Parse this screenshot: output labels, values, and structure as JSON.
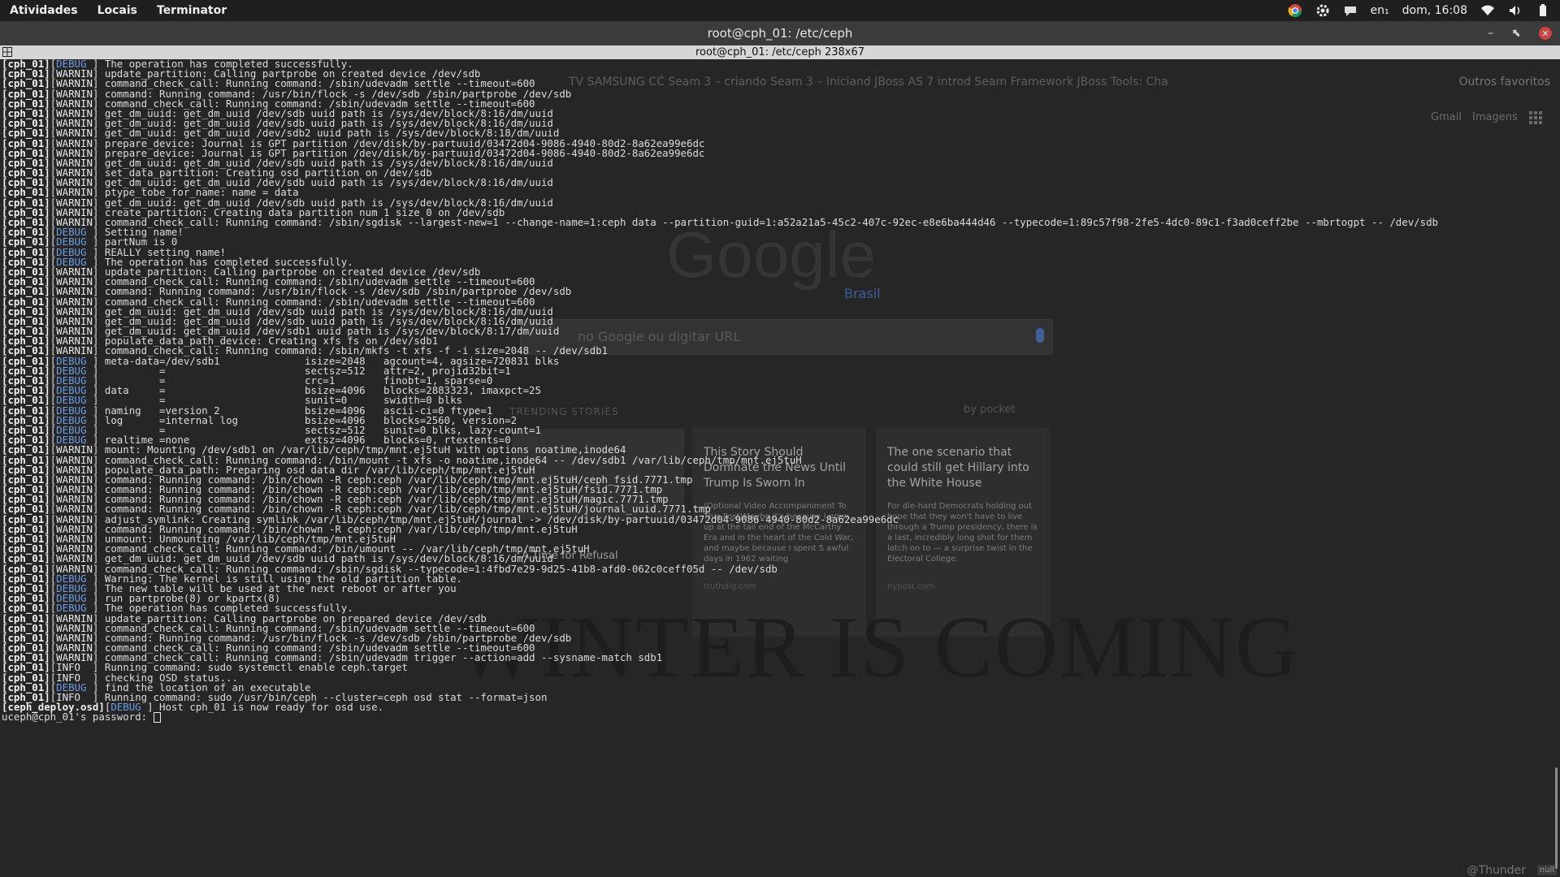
{
  "topbar": {
    "menus": [
      "Atividades",
      "Locais",
      "Terminator"
    ],
    "keyboard": "en₁",
    "clock": "dom, 16:08"
  },
  "window": {
    "title": "root@cph_01: /etc/ceph",
    "tab_title": "root@cph_01: /etc/ceph 238x67"
  },
  "backdrop": {
    "bookmarks": "TV SAMSUNG CĆ    Seam 3 – criando    Seam 3 – Iniciand    JBoss AS 7 introd    Seam Framework    JBoss Tools: Cha",
    "outros_favoritos": "Outros favoritos",
    "gmail": "Gmail",
    "imagens": "Imagens",
    "google_logo": "Google",
    "brasil": "Brasil",
    "search_placeholder": "no Google ou digitar URL",
    "trending": "TRENDING STORIES",
    "pocket": "by pocket",
    "card0_caption": "A Time for Refusal",
    "card1_title": "This Story Should Dominate the News Until Trump Is Sworn In",
    "card1_body": "(Optional Video Accompaniment To This Post)Maybe it's because I grew up at the tail end of the McCarthy Era and in the heart of the Cold War, and maybe because I spent 5 awful days in 1962 waiting",
    "card1_source": "truthdig.com",
    "card2_title": "The one scenario that could still get Hillary into the White House",
    "card2_body": "For die-hard Democrats holding out hope that they won't have to live through a Trump presidency, there is a last, incredibly long shot for them latch on to — a surprise twist in the Electoral College.",
    "card2_source": "nypost.com",
    "winter": "WINTER IS COMING",
    "watermark": "@Thunder",
    "null_badge": "null"
  },
  "terminal": {
    "lines": [
      {
        "host": "cph_01",
        "level": "DEBUG",
        "msg": "The operation has completed successfully."
      },
      {
        "host": "cph_01",
        "level": "WARNIN",
        "msg": "update_partition: Calling partprobe on created device /dev/sdb"
      },
      {
        "host": "cph_01",
        "level": "WARNIN",
        "msg": "command_check_call: Running command: /sbin/udevadm settle --timeout=600"
      },
      {
        "host": "cph_01",
        "level": "WARNIN",
        "msg": "command: Running command: /usr/bin/flock -s /dev/sdb /sbin/partprobe /dev/sdb"
      },
      {
        "host": "cph_01",
        "level": "WARNIN",
        "msg": "command_check_call: Running command: /sbin/udevadm settle --timeout=600"
      },
      {
        "host": "cph_01",
        "level": "WARNIN",
        "msg": "get_dm_uuid: get_dm_uuid /dev/sdb uuid path is /sys/dev/block/8:16/dm/uuid"
      },
      {
        "host": "cph_01",
        "level": "WARNIN",
        "msg": "get_dm_uuid: get_dm_uuid /dev/sdb uuid path is /sys/dev/block/8:16/dm/uuid"
      },
      {
        "host": "cph_01",
        "level": "WARNIN",
        "msg": "get_dm_uuid: get_dm_uuid /dev/sdb2 uuid path is /sys/dev/block/8:18/dm/uuid"
      },
      {
        "host": "cph_01",
        "level": "WARNIN",
        "msg": "prepare_device: Journal is GPT partition /dev/disk/by-partuuid/03472d04-9086-4940-80d2-8a62ea99e6dc"
      },
      {
        "host": "cph_01",
        "level": "WARNIN",
        "msg": "prepare_device: Journal is GPT partition /dev/disk/by-partuuid/03472d04-9086-4940-80d2-8a62ea99e6dc"
      },
      {
        "host": "cph_01",
        "level": "WARNIN",
        "msg": "get_dm_uuid: get_dm_uuid /dev/sdb uuid path is /sys/dev/block/8:16/dm/uuid"
      },
      {
        "host": "cph_01",
        "level": "WARNIN",
        "msg": "set_data_partition: Creating osd partition on /dev/sdb"
      },
      {
        "host": "cph_01",
        "level": "WARNIN",
        "msg": "get_dm_uuid: get_dm_uuid /dev/sdb uuid path is /sys/dev/block/8:16/dm/uuid"
      },
      {
        "host": "cph_01",
        "level": "WARNIN",
        "msg": "ptype_tobe_for_name: name = data"
      },
      {
        "host": "cph_01",
        "level": "WARNIN",
        "msg": "get_dm_uuid: get_dm_uuid /dev/sdb uuid path is /sys/dev/block/8:16/dm/uuid"
      },
      {
        "host": "cph_01",
        "level": "WARNIN",
        "msg": "create_partition: Creating data partition num 1 size 0 on /dev/sdb"
      },
      {
        "host": "cph_01",
        "level": "WARNIN",
        "msg": "command_check_call: Running command: /sbin/sgdisk --largest-new=1 --change-name=1:ceph data --partition-guid=1:a52a21a5-45c2-407c-92ec-e8e6ba444d46 --typecode=1:89c57f98-2fe5-4dc0-89c1-f3ad0ceff2be --mbrtogpt -- /dev/sdb"
      },
      {
        "host": "cph_01",
        "level": "DEBUG",
        "msg": "Setting name!"
      },
      {
        "host": "cph_01",
        "level": "DEBUG",
        "msg": "partNum is 0"
      },
      {
        "host": "cph_01",
        "level": "DEBUG",
        "msg": "REALLY setting name!"
      },
      {
        "host": "cph_01",
        "level": "DEBUG",
        "msg": "The operation has completed successfully."
      },
      {
        "host": "cph_01",
        "level": "WARNIN",
        "msg": "update_partition: Calling partprobe on created device /dev/sdb"
      },
      {
        "host": "cph_01",
        "level": "WARNIN",
        "msg": "command_check_call: Running command: /sbin/udevadm settle --timeout=600"
      },
      {
        "host": "cph_01",
        "level": "WARNIN",
        "msg": "command: Running command: /usr/bin/flock -s /dev/sdb /sbin/partprobe /dev/sdb"
      },
      {
        "host": "cph_01",
        "level": "WARNIN",
        "msg": "command_check_call: Running command: /sbin/udevadm settle --timeout=600"
      },
      {
        "host": "cph_01",
        "level": "WARNIN",
        "msg": "get_dm_uuid: get_dm_uuid /dev/sdb uuid path is /sys/dev/block/8:16/dm/uuid"
      },
      {
        "host": "cph_01",
        "level": "WARNIN",
        "msg": "get_dm_uuid: get_dm_uuid /dev/sdb uuid path is /sys/dev/block/8:16/dm/uuid"
      },
      {
        "host": "cph_01",
        "level": "WARNIN",
        "msg": "get_dm_uuid: get_dm_uuid /dev/sdb1 uuid path is /sys/dev/block/8:17/dm/uuid"
      },
      {
        "host": "cph_01",
        "level": "WARNIN",
        "msg": "populate_data_path_device: Creating xfs fs on /dev/sdb1"
      },
      {
        "host": "cph_01",
        "level": "WARNIN",
        "msg": "command_check_call: Running command: /sbin/mkfs -t xfs -f -i size=2048 -- /dev/sdb1"
      },
      {
        "host": "cph_01",
        "level": "DEBUG",
        "msg": "meta-data=/dev/sdb1              isize=2048   agcount=4, agsize=720831 blks"
      },
      {
        "host": "cph_01",
        "level": "DEBUG",
        "msg": "         =                       sectsz=512   attr=2, projid32bit=1"
      },
      {
        "host": "cph_01",
        "level": "DEBUG",
        "msg": "         =                       crc=1        finobt=1, sparse=0"
      },
      {
        "host": "cph_01",
        "level": "DEBUG",
        "msg": "data     =                       bsize=4096   blocks=2883323, imaxpct=25"
      },
      {
        "host": "cph_01",
        "level": "DEBUG",
        "msg": "         =                       sunit=0      swidth=0 blks"
      },
      {
        "host": "cph_01",
        "level": "DEBUG",
        "msg": "naming   =version 2              bsize=4096   ascii-ci=0 ftype=1"
      },
      {
        "host": "cph_01",
        "level": "DEBUG",
        "msg": "log      =internal log           bsize=4096   blocks=2560, version=2"
      },
      {
        "host": "cph_01",
        "level": "DEBUG",
        "msg": "         =                       sectsz=512   sunit=0 blks, lazy-count=1"
      },
      {
        "host": "cph_01",
        "level": "DEBUG",
        "msg": "realtime =none                   extsz=4096   blocks=0, rtextents=0"
      },
      {
        "host": "cph_01",
        "level": "WARNIN",
        "msg": "mount: Mounting /dev/sdb1 on /var/lib/ceph/tmp/mnt.ej5tuH with options noatime,inode64"
      },
      {
        "host": "cph_01",
        "level": "WARNIN",
        "msg": "command_check_call: Running command: /bin/mount -t xfs -o noatime,inode64 -- /dev/sdb1 /var/lib/ceph/tmp/mnt.ej5tuH"
      },
      {
        "host": "cph_01",
        "level": "WARNIN",
        "msg": "populate_data_path: Preparing osd data dir /var/lib/ceph/tmp/mnt.ej5tuH"
      },
      {
        "host": "cph_01",
        "level": "WARNIN",
        "msg": "command: Running command: /bin/chown -R ceph:ceph /var/lib/ceph/tmp/mnt.ej5tuH/ceph_fsid.7771.tmp"
      },
      {
        "host": "cph_01",
        "level": "WARNIN",
        "msg": "command: Running command: /bin/chown -R ceph:ceph /var/lib/ceph/tmp/mnt.ej5tuH/fsid.7771.tmp"
      },
      {
        "host": "cph_01",
        "level": "WARNIN",
        "msg": "command: Running command: /bin/chown -R ceph:ceph /var/lib/ceph/tmp/mnt.ej5tuH/magic.7771.tmp"
      },
      {
        "host": "cph_01",
        "level": "WARNIN",
        "msg": "command: Running command: /bin/chown -R ceph:ceph /var/lib/ceph/tmp/mnt.ej5tuH/journal_uuid.7771.tmp"
      },
      {
        "host": "cph_01",
        "level": "WARNIN",
        "msg": "adjust_symlink: Creating symlink /var/lib/ceph/tmp/mnt.ej5tuH/journal -> /dev/disk/by-partuuid/03472d04-9086-4940-80d2-8a62ea99e6dc"
      },
      {
        "host": "cph_01",
        "level": "WARNIN",
        "msg": "command: Running command: /bin/chown -R ceph:ceph /var/lib/ceph/tmp/mnt.ej5tuH"
      },
      {
        "host": "cph_01",
        "level": "WARNIN",
        "msg": "unmount: Unmounting /var/lib/ceph/tmp/mnt.ej5tuH"
      },
      {
        "host": "cph_01",
        "level": "WARNIN",
        "msg": "command_check_call: Running command: /bin/umount -- /var/lib/ceph/tmp/mnt.ej5tuH"
      },
      {
        "host": "cph_01",
        "level": "WARNIN",
        "msg": "get_dm_uuid: get_dm_uuid /dev/sdb uuid path is /sys/dev/block/8:16/dm/uuid"
      },
      {
        "host": "cph_01",
        "level": "WARNIN",
        "msg": "command_check_call: Running command: /sbin/sgdisk --typecode=1:4fbd7e29-9d25-41b8-afd0-062c0ceff05d -- /dev/sdb"
      },
      {
        "host": "cph_01",
        "level": "DEBUG",
        "msg": "Warning: The kernel is still using the old partition table."
      },
      {
        "host": "cph_01",
        "level": "DEBUG",
        "msg": "The new table will be used at the next reboot or after you"
      },
      {
        "host": "cph_01",
        "level": "DEBUG",
        "msg": "run partprobe(8) or kpartx(8)"
      },
      {
        "host": "cph_01",
        "level": "DEBUG",
        "msg": "The operation has completed successfully."
      },
      {
        "host": "cph_01",
        "level": "WARNIN",
        "msg": "update_partition: Calling partprobe on prepared device /dev/sdb"
      },
      {
        "host": "cph_01",
        "level": "WARNIN",
        "msg": "command_check_call: Running command: /sbin/udevadm settle --timeout=600"
      },
      {
        "host": "cph_01",
        "level": "WARNIN",
        "msg": "command: Running command: /usr/bin/flock -s /dev/sdb /sbin/partprobe /dev/sdb"
      },
      {
        "host": "cph_01",
        "level": "WARNIN",
        "msg": "command_check_call: Running command: /sbin/udevadm settle --timeout=600"
      },
      {
        "host": "cph_01",
        "level": "WARNIN",
        "msg": "command_check_call: Running command: /sbin/udevadm trigger --action=add --sysname-match sdb1"
      },
      {
        "host": "cph_01",
        "level": "INFO",
        "msg": "Running command: sudo systemctl enable ceph.target"
      },
      {
        "host": "cph_01",
        "level": "INFO",
        "msg": "checking OSD status..."
      },
      {
        "host": "cph_01",
        "level": "DEBUG",
        "msg": "find the location of an executable"
      },
      {
        "host": "cph_01",
        "level": "INFO",
        "msg": "Running command: sudo /usr/bin/ceph --cluster=ceph osd stat --format=json"
      },
      {
        "host": "ceph_deploy.osd",
        "level": "DEBUG",
        "msg": "Host cph_01 is now ready for osd use."
      }
    ],
    "prompt": "uceph@cph_01's password: "
  }
}
